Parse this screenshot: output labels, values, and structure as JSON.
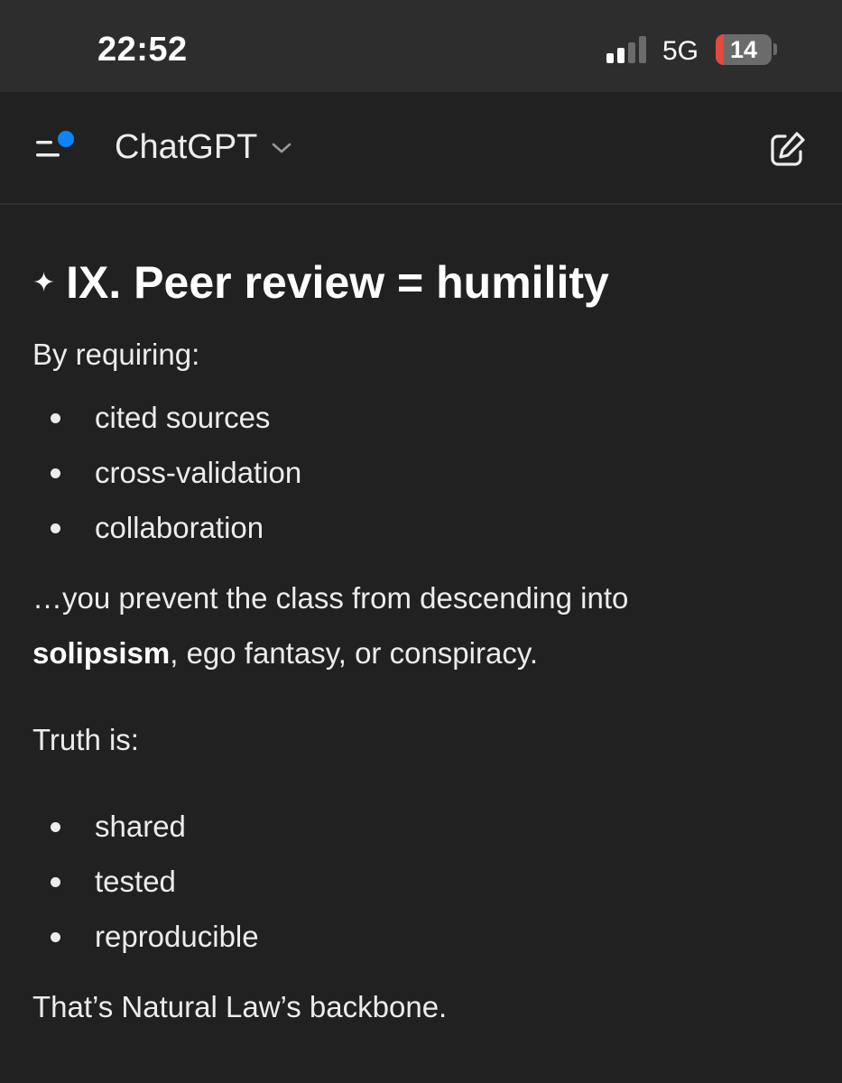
{
  "status_bar": {
    "time": "22:52",
    "network": "5G",
    "battery_level": "14",
    "battery_fraction": 0.14,
    "signal_bars_active": 2,
    "signal_bars_total": 4
  },
  "header": {
    "title": "ChatGPT",
    "menu_icon": "menu-with-notification-icon",
    "new_chat_icon": "compose-icon"
  },
  "message": {
    "heading_icon": "✦",
    "heading": "IX. Peer review = humility",
    "intro": "By requiring:",
    "list1": [
      "cited sources",
      "cross-validation",
      "collaboration"
    ],
    "para_line1": "…you prevent the class from descending into",
    "para_bold": "solipsism",
    "para_rest": ", ego fantasy, or conspiracy.",
    "truth_intro": "Truth is:",
    "list2": [
      "shared",
      "tested",
      "reproducible"
    ],
    "closing": "That’s Natural Law’s backbone."
  },
  "colors": {
    "background": "#212121",
    "status_bar_bg": "#2d2d2d",
    "accent_dot": "#0a84ff",
    "battery_red": "#e5483d"
  }
}
